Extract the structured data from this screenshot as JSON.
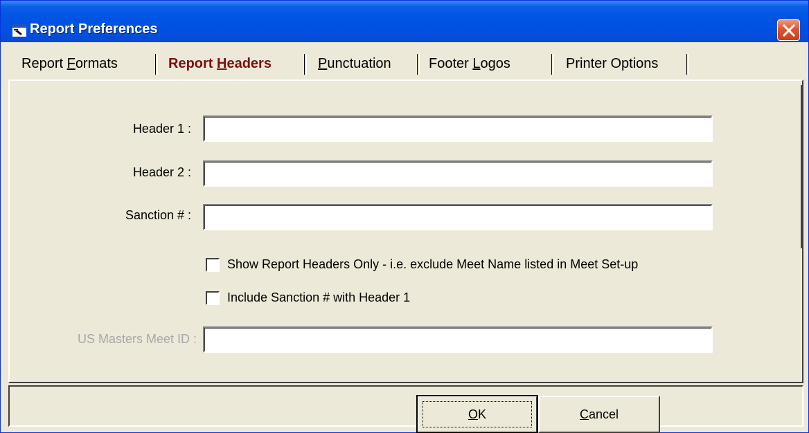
{
  "window": {
    "title": "Report Preferences"
  },
  "tabs": [
    {
      "label": "Report Formats",
      "accel": "F",
      "active": false
    },
    {
      "label": "Report Headers",
      "accel": "H",
      "active": true
    },
    {
      "label": "Punctuation",
      "accel": "P",
      "active": false
    },
    {
      "label": "Footer Logos",
      "accel": "L",
      "active": false
    },
    {
      "label": "Printer Options",
      "accel": "",
      "active": false
    }
  ],
  "form": {
    "header1": {
      "label": "Header 1 :",
      "value": ""
    },
    "header2": {
      "label": "Header 2 :",
      "value": ""
    },
    "sanction": {
      "label": "Sanction # :",
      "value": ""
    },
    "show_headers_only": {
      "label": "Show Report Headers Only - i.e. exclude Meet Name listed in Meet Set-up",
      "checked": false
    },
    "include_sanction": {
      "label": "Include Sanction # with Header 1",
      "checked": false
    },
    "usms_meet_id": {
      "label": "US Masters Meet ID :",
      "value": "",
      "disabled": true
    }
  },
  "buttons": {
    "ok": "OK",
    "cancel": "Cancel"
  },
  "colors": {
    "titlebar": "#0054e3",
    "face": "#ece9d8",
    "active_tab_text": "#7a1010",
    "close": "#e0552e"
  },
  "icons": {
    "title": "window-app-icon",
    "close": "close-x-icon"
  }
}
